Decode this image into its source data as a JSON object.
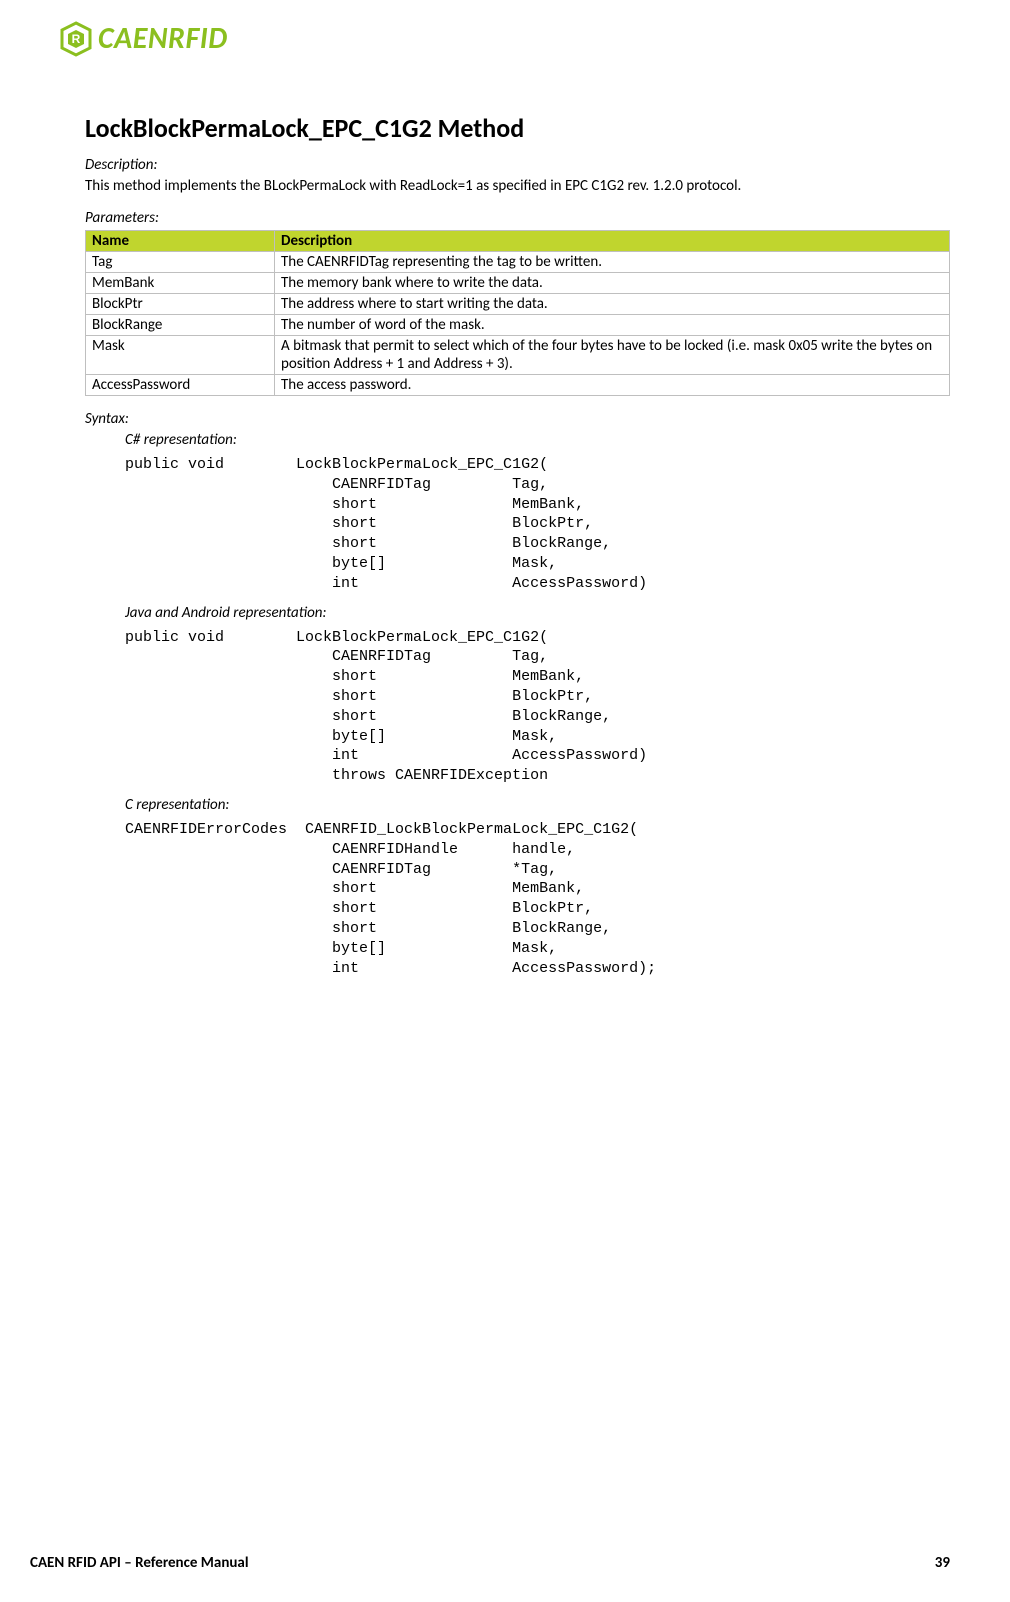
{
  "brand": "CAENRFID",
  "title": "LockBlockPermaLock_EPC_C1G2 Method",
  "description_label": "Description:",
  "description_text": "This method implements the BLockPermaLock with ReadLock=1 as specified in EPC C1G2 rev. 1.2.0 protocol.",
  "parameters_label": "Parameters:",
  "table": {
    "headers": {
      "name": "Name",
      "desc": "Description"
    },
    "rows": [
      {
        "name": "Tag",
        "desc": "The CAENRFIDTag representing the tag to be written."
      },
      {
        "name": "MemBank",
        "desc": "The memory bank where to write the data."
      },
      {
        "name": "BlockPtr",
        "desc": "The address where to start writing the data."
      },
      {
        "name": "BlockRange",
        "desc": "The number of word of the mask."
      },
      {
        "name": "Mask",
        "desc": "A bitmask that permit to select which of the four bytes have to be locked (i.e. mask 0x05 write the bytes on position Address + 1 and Address + 3)."
      },
      {
        "name": "AccessPassword",
        "desc": "The access password."
      }
    ]
  },
  "syntax_label": "Syntax:",
  "csharp_label": "C# representation:",
  "csharp_code": "public void        LockBlockPermaLock_EPC_C1G2(\n                       CAENRFIDTag         Tag,\n                       short               MemBank,\n                       short               BlockPtr,\n                       short               BlockRange,\n                       byte[]              Mask,\n                       int                 AccessPassword)",
  "java_label": "Java and Android representation:",
  "java_code": "public void        LockBlockPermaLock_EPC_C1G2(\n                       CAENRFIDTag         Tag,\n                       short               MemBank,\n                       short               BlockPtr,\n                       short               BlockRange,\n                       byte[]              Mask,\n                       int                 AccessPassword)\n                       throws CAENRFIDException",
  "c_label": "C representation:",
  "c_code": "CAENRFIDErrorCodes  CAENRFID_LockBlockPermaLock_EPC_C1G2(\n                       CAENRFIDHandle      handle,\n                       CAENRFIDTag         *Tag,\n                       short               MemBank,\n                       short               BlockPtr,\n                       short               BlockRange,\n                       byte[]              Mask,\n                       int                 AccessPassword);",
  "footer_left": "CAEN RFID API – Reference Manual",
  "footer_right": "39"
}
